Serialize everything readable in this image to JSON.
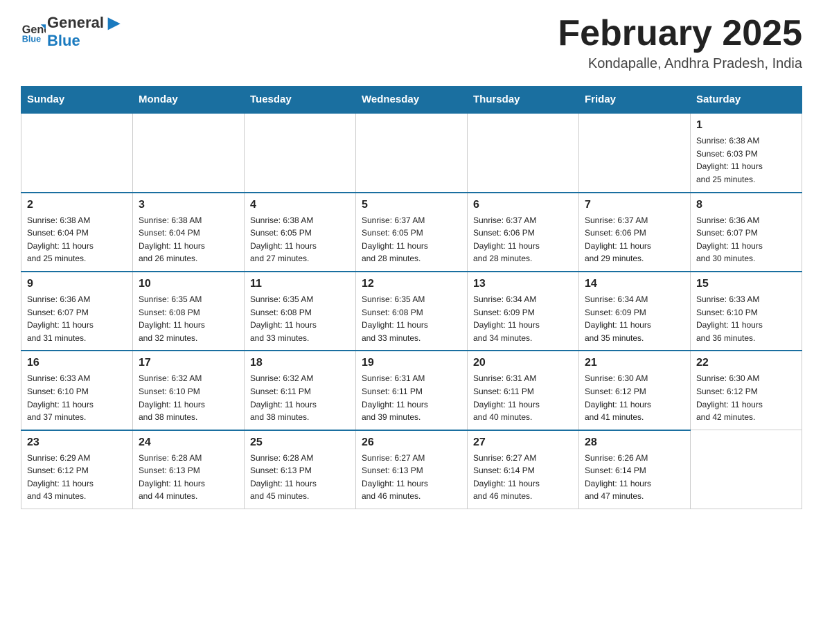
{
  "header": {
    "logo_text_general": "General",
    "logo_text_blue": "Blue",
    "month_title": "February 2025",
    "location": "Kondapalle, Andhra Pradesh, India"
  },
  "days_of_week": [
    "Sunday",
    "Monday",
    "Tuesday",
    "Wednesday",
    "Thursday",
    "Friday",
    "Saturday"
  ],
  "weeks": [
    [
      {
        "day": "",
        "info": ""
      },
      {
        "day": "",
        "info": ""
      },
      {
        "day": "",
        "info": ""
      },
      {
        "day": "",
        "info": ""
      },
      {
        "day": "",
        "info": ""
      },
      {
        "day": "",
        "info": ""
      },
      {
        "day": "1",
        "info": "Sunrise: 6:38 AM\nSunset: 6:03 PM\nDaylight: 11 hours\nand 25 minutes."
      }
    ],
    [
      {
        "day": "2",
        "info": "Sunrise: 6:38 AM\nSunset: 6:04 PM\nDaylight: 11 hours\nand 25 minutes."
      },
      {
        "day": "3",
        "info": "Sunrise: 6:38 AM\nSunset: 6:04 PM\nDaylight: 11 hours\nand 26 minutes."
      },
      {
        "day": "4",
        "info": "Sunrise: 6:38 AM\nSunset: 6:05 PM\nDaylight: 11 hours\nand 27 minutes."
      },
      {
        "day": "5",
        "info": "Sunrise: 6:37 AM\nSunset: 6:05 PM\nDaylight: 11 hours\nand 28 minutes."
      },
      {
        "day": "6",
        "info": "Sunrise: 6:37 AM\nSunset: 6:06 PM\nDaylight: 11 hours\nand 28 minutes."
      },
      {
        "day": "7",
        "info": "Sunrise: 6:37 AM\nSunset: 6:06 PM\nDaylight: 11 hours\nand 29 minutes."
      },
      {
        "day": "8",
        "info": "Sunrise: 6:36 AM\nSunset: 6:07 PM\nDaylight: 11 hours\nand 30 minutes."
      }
    ],
    [
      {
        "day": "9",
        "info": "Sunrise: 6:36 AM\nSunset: 6:07 PM\nDaylight: 11 hours\nand 31 minutes."
      },
      {
        "day": "10",
        "info": "Sunrise: 6:35 AM\nSunset: 6:08 PM\nDaylight: 11 hours\nand 32 minutes."
      },
      {
        "day": "11",
        "info": "Sunrise: 6:35 AM\nSunset: 6:08 PM\nDaylight: 11 hours\nand 33 minutes."
      },
      {
        "day": "12",
        "info": "Sunrise: 6:35 AM\nSunset: 6:08 PM\nDaylight: 11 hours\nand 33 minutes."
      },
      {
        "day": "13",
        "info": "Sunrise: 6:34 AM\nSunset: 6:09 PM\nDaylight: 11 hours\nand 34 minutes."
      },
      {
        "day": "14",
        "info": "Sunrise: 6:34 AM\nSunset: 6:09 PM\nDaylight: 11 hours\nand 35 minutes."
      },
      {
        "day": "15",
        "info": "Sunrise: 6:33 AM\nSunset: 6:10 PM\nDaylight: 11 hours\nand 36 minutes."
      }
    ],
    [
      {
        "day": "16",
        "info": "Sunrise: 6:33 AM\nSunset: 6:10 PM\nDaylight: 11 hours\nand 37 minutes."
      },
      {
        "day": "17",
        "info": "Sunrise: 6:32 AM\nSunset: 6:10 PM\nDaylight: 11 hours\nand 38 minutes."
      },
      {
        "day": "18",
        "info": "Sunrise: 6:32 AM\nSunset: 6:11 PM\nDaylight: 11 hours\nand 38 minutes."
      },
      {
        "day": "19",
        "info": "Sunrise: 6:31 AM\nSunset: 6:11 PM\nDaylight: 11 hours\nand 39 minutes."
      },
      {
        "day": "20",
        "info": "Sunrise: 6:31 AM\nSunset: 6:11 PM\nDaylight: 11 hours\nand 40 minutes."
      },
      {
        "day": "21",
        "info": "Sunrise: 6:30 AM\nSunset: 6:12 PM\nDaylight: 11 hours\nand 41 minutes."
      },
      {
        "day": "22",
        "info": "Sunrise: 6:30 AM\nSunset: 6:12 PM\nDaylight: 11 hours\nand 42 minutes."
      }
    ],
    [
      {
        "day": "23",
        "info": "Sunrise: 6:29 AM\nSunset: 6:12 PM\nDaylight: 11 hours\nand 43 minutes."
      },
      {
        "day": "24",
        "info": "Sunrise: 6:28 AM\nSunset: 6:13 PM\nDaylight: 11 hours\nand 44 minutes."
      },
      {
        "day": "25",
        "info": "Sunrise: 6:28 AM\nSunset: 6:13 PM\nDaylight: 11 hours\nand 45 minutes."
      },
      {
        "day": "26",
        "info": "Sunrise: 6:27 AM\nSunset: 6:13 PM\nDaylight: 11 hours\nand 46 minutes."
      },
      {
        "day": "27",
        "info": "Sunrise: 6:27 AM\nSunset: 6:14 PM\nDaylight: 11 hours\nand 46 minutes."
      },
      {
        "day": "28",
        "info": "Sunrise: 6:26 AM\nSunset: 6:14 PM\nDaylight: 11 hours\nand 47 minutes."
      },
      {
        "day": "",
        "info": ""
      }
    ]
  ]
}
